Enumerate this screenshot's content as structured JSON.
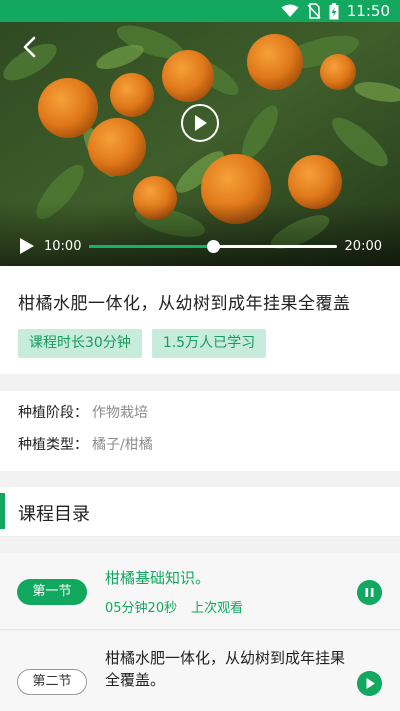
{
  "status_bar": {
    "time": "11:50",
    "icons": [
      "wifi-icon",
      "no-sim-icon",
      "battery-charging-icon"
    ],
    "color": "#13a85f"
  },
  "video": {
    "current_time": "10:00",
    "total_time": "20:00",
    "progress": 0.5,
    "icons": [
      "back-arrow-icon",
      "play-circle-icon",
      "play-icon"
    ]
  },
  "course": {
    "title": "柑橘水肥一体化，从幼树到成年挂果全覆盖",
    "duration_tag": "课程时长30分钟",
    "learners_tag": "1.5万人已学习"
  },
  "info": {
    "stage_label": "种植阶段：",
    "stage_value": "作物栽培",
    "type_label": "种植类型：",
    "type_value": "橘子/柑橘"
  },
  "catalog": {
    "header": "课程目录",
    "lessons": [
      {
        "badge": "第一节",
        "title": "柑橘基础知识。",
        "duration": "05分钟20秒",
        "status": "上次观看",
        "icon": "pause-icon"
      },
      {
        "badge": "第二节",
        "title": "柑橘水肥一体化，从幼树到成年挂果全覆盖。",
        "icon": "play-icon"
      }
    ]
  },
  "colors": {
    "accent": "#13a85f",
    "tag_bg": "#c7ecdc",
    "tag_text": "#1a9a5e"
  }
}
